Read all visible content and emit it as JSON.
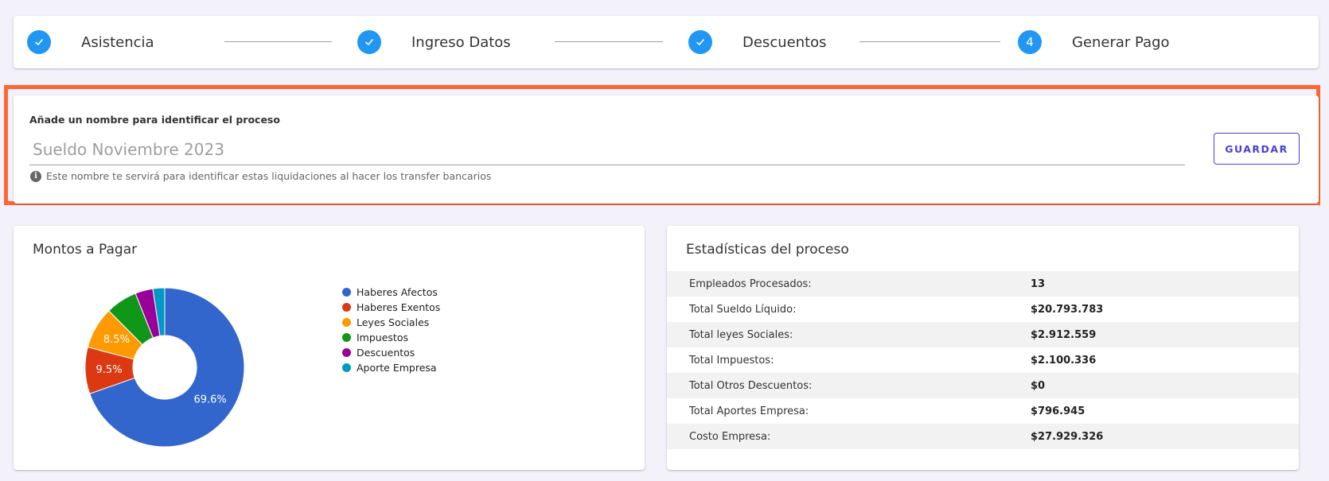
{
  "stepper": {
    "steps": [
      {
        "label": "Asistencia",
        "status": "done",
        "icon": "check-icon"
      },
      {
        "label": "Ingreso Datos",
        "status": "done",
        "icon": "check-icon"
      },
      {
        "label": "Descuentos",
        "status": "done",
        "icon": "check-icon"
      },
      {
        "label": "Generar Pago",
        "status": "current",
        "number": "4"
      }
    ],
    "accent_color": "#2196f3"
  },
  "process_name": {
    "label": "Añade un nombre para identificar el proceso",
    "placeholder": "Sueldo Noviembre 2023",
    "value": "",
    "help_text": "Este nombre te servirá para identificar estas liquidaciones al hacer los transfer bancarios",
    "save_label": "GUARDAR",
    "highlight_color": "#ff6633"
  },
  "chart_card": {
    "title": "Montos a Pagar"
  },
  "chart_data": {
    "type": "pie",
    "donut": true,
    "categories": [
      "Haberes Afectos",
      "Haberes Exentos",
      "Leyes Sociales",
      "Impuestos",
      "Descuentos",
      "Aporte Empresa"
    ],
    "values": [
      69.6,
      9.5,
      8.5,
      6.4,
      3.6,
      2.4
    ],
    "data_labels": [
      "69.6%",
      "9.5%",
      "8.5%",
      "",
      "",
      ""
    ],
    "colors": [
      "#3366cc",
      "#dc3912",
      "#ff9900",
      "#109618",
      "#990099",
      "#0099c6"
    ],
    "legend_position": "right"
  },
  "stats": {
    "title": "Estadísticas del proceso",
    "rows": [
      {
        "label": "Empleados Procesados:",
        "value": "13"
      },
      {
        "label": "Total Sueldo Líquido:",
        "value": "$20.793.783"
      },
      {
        "label": "Total leyes Sociales:",
        "value": "$2.912.559"
      },
      {
        "label": "Total Impuestos:",
        "value": "$2.100.336"
      },
      {
        "label": "Total Otros Descuentos:",
        "value": "$0"
      },
      {
        "label": "Total Aportes Empresa:",
        "value": "$796.945"
      },
      {
        "label": "Costo Empresa:",
        "value": "$27.929.326"
      }
    ]
  }
}
